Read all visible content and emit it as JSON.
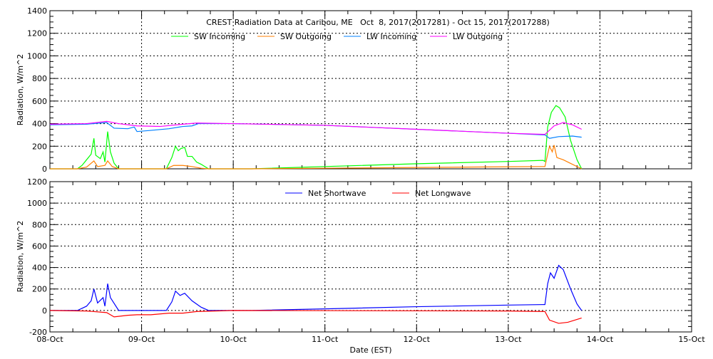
{
  "chart_data": [
    {
      "type": "line",
      "title": "CREST Radiation Data at Caribou, ME   Oct  8, 2017(2017281) - Oct 15, 2017(2017288)",
      "xlabel": "",
      "ylabel": "Radiation, W/m^2",
      "ylim": [
        0,
        1400
      ],
      "yticks": [
        "0",
        "200",
        "400",
        "600",
        "800",
        "1000",
        "1200",
        "1400"
      ],
      "xlim": [
        0,
        7
      ],
      "grid": true,
      "legend": "top",
      "series": [
        {
          "name": "SW Incoming",
          "color": "#00ff00",
          "points": [
            [
              0,
              0
            ],
            [
              0.3,
              0
            ],
            [
              0.35,
              30
            ],
            [
              0.4,
              80
            ],
            [
              0.45,
              130
            ],
            [
              0.48,
              270
            ],
            [
              0.5,
              120
            ],
            [
              0.55,
              90
            ],
            [
              0.58,
              150
            ],
            [
              0.6,
              60
            ],
            [
              0.63,
              330
            ],
            [
              0.66,
              150
            ],
            [
              0.7,
              50
            ],
            [
              0.75,
              0
            ],
            [
              1.27,
              0
            ],
            [
              1.33,
              100
            ],
            [
              1.37,
              200
            ],
            [
              1.4,
              160
            ],
            [
              1.43,
              180
            ],
            [
              1.47,
              190
            ],
            [
              1.5,
              110
            ],
            [
              1.55,
              110
            ],
            [
              1.6,
              60
            ],
            [
              1.65,
              40
            ],
            [
              1.73,
              0
            ],
            [
              2.2,
              0
            ],
            [
              3,
              20
            ],
            [
              4,
              45
            ],
            [
              5,
              65
            ],
            [
              5.38,
              75
            ],
            [
              5.4,
              65
            ],
            [
              5.43,
              370
            ],
            [
              5.47,
              500
            ],
            [
              5.52,
              560
            ],
            [
              5.56,
              540
            ],
            [
              5.62,
              460
            ],
            [
              5.68,
              250
            ],
            [
              5.75,
              80
            ],
            [
              5.8,
              0
            ]
          ]
        },
        {
          "name": "SW Outgoing",
          "color": "#ff7f00",
          "points": [
            [
              0,
              0
            ],
            [
              0.3,
              0
            ],
            [
              0.4,
              15
            ],
            [
              0.48,
              70
            ],
            [
              0.52,
              20
            ],
            [
              0.6,
              30
            ],
            [
              0.63,
              70
            ],
            [
              0.68,
              20
            ],
            [
              0.75,
              0
            ],
            [
              1.27,
              0
            ],
            [
              1.35,
              30
            ],
            [
              1.45,
              30
            ],
            [
              1.55,
              20
            ],
            [
              1.65,
              5
            ],
            [
              1.73,
              0
            ],
            [
              2.2,
              0
            ],
            [
              3,
              5
            ],
            [
              4,
              12
            ],
            [
              5,
              18
            ],
            [
              5.4,
              20
            ],
            [
              5.43,
              130
            ],
            [
              5.45,
              200
            ],
            [
              5.48,
              150
            ],
            [
              5.5,
              210
            ],
            [
              5.53,
              100
            ],
            [
              5.6,
              80
            ],
            [
              5.7,
              40
            ],
            [
              5.8,
              0
            ]
          ]
        },
        {
          "name": "LW Incoming",
          "color": "#0080ff",
          "points": [
            [
              0,
              390
            ],
            [
              0.4,
              395
            ],
            [
              0.62,
              410
            ],
            [
              0.7,
              360
            ],
            [
              0.85,
              355
            ],
            [
              0.92,
              370
            ],
            [
              0.95,
              330
            ],
            [
              1.1,
              340
            ],
            [
              1.3,
              355
            ],
            [
              1.45,
              375
            ],
            [
              1.55,
              380
            ],
            [
              1.62,
              400
            ],
            [
              2,
              400
            ],
            [
              3,
              385
            ],
            [
              4,
              350
            ],
            [
              5,
              315
            ],
            [
              5.4,
              300
            ],
            [
              5.45,
              270
            ],
            [
              5.55,
              285
            ],
            [
              5.7,
              290
            ],
            [
              5.8,
              280
            ]
          ]
        },
        {
          "name": "LW Outgoing",
          "color": "#ff00ff",
          "points": [
            [
              0,
              395
            ],
            [
              0.4,
              400
            ],
            [
              0.62,
              420
            ],
            [
              0.75,
              400
            ],
            [
              0.95,
              380
            ],
            [
              1.2,
              375
            ],
            [
              1.45,
              395
            ],
            [
              1.6,
              405
            ],
            [
              2,
              400
            ],
            [
              3,
              385
            ],
            [
              4,
              350
            ],
            [
              5,
              315
            ],
            [
              5.4,
              305
            ],
            [
              5.5,
              380
            ],
            [
              5.6,
              410
            ],
            [
              5.7,
              390
            ],
            [
              5.8,
              350
            ]
          ]
        }
      ]
    },
    {
      "type": "line",
      "title": "",
      "xlabel": "Date (EST)",
      "ylabel": "Radiation, W/m^2",
      "ylim": [
        -200,
        1200
      ],
      "yticks": [
        "-200",
        "0",
        "200",
        "400",
        "600",
        "800",
        "1000",
        "1200"
      ],
      "xlim": [
        0,
        7
      ],
      "xticks": [
        "08-Oct",
        "09-Oct",
        "10-Oct",
        "11-Oct",
        "12-Oct",
        "13-Oct",
        "14-Oct",
        "15-Oct"
      ],
      "grid": true,
      "legend": "top",
      "series": [
        {
          "name": "Net Shortwave",
          "color": "#0000ff",
          "points": [
            [
              0,
              0
            ],
            [
              0.3,
              0
            ],
            [
              0.4,
              40
            ],
            [
              0.45,
              90
            ],
            [
              0.48,
              200
            ],
            [
              0.52,
              70
            ],
            [
              0.58,
              120
            ],
            [
              0.6,
              40
            ],
            [
              0.63,
              250
            ],
            [
              0.66,
              120
            ],
            [
              0.75,
              0
            ],
            [
              1.27,
              0
            ],
            [
              1.33,
              80
            ],
            [
              1.37,
              180
            ],
            [
              1.42,
              140
            ],
            [
              1.47,
              160
            ],
            [
              1.55,
              90
            ],
            [
              1.65,
              30
            ],
            [
              1.73,
              0
            ],
            [
              2.2,
              0
            ],
            [
              3,
              15
            ],
            [
              4,
              35
            ],
            [
              5,
              50
            ],
            [
              5.4,
              55
            ],
            [
              5.43,
              250
            ],
            [
              5.46,
              350
            ],
            [
              5.5,
              300
            ],
            [
              5.55,
              420
            ],
            [
              5.6,
              380
            ],
            [
              5.68,
              200
            ],
            [
              5.75,
              60
            ],
            [
              5.8,
              0
            ]
          ]
        },
        {
          "name": "Net Longwave",
          "color": "#ff0000",
          "points": [
            [
              0,
              0
            ],
            [
              0.4,
              -5
            ],
            [
              0.62,
              -20
            ],
            [
              0.7,
              -60
            ],
            [
              0.85,
              -45
            ],
            [
              0.95,
              -40
            ],
            [
              1.1,
              -40
            ],
            [
              1.3,
              -25
            ],
            [
              1.45,
              -25
            ],
            [
              1.6,
              -10
            ],
            [
              2,
              0
            ],
            [
              5,
              -5
            ],
            [
              5.4,
              -10
            ],
            [
              5.45,
              -90
            ],
            [
              5.55,
              -120
            ],
            [
              5.65,
              -110
            ],
            [
              5.8,
              -70
            ]
          ]
        }
      ]
    }
  ]
}
